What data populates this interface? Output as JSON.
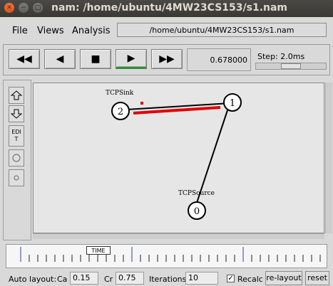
{
  "window": {
    "title": "nam: /home/ubuntu/4MW23CS153/s1.nam",
    "close_icon": "close-icon",
    "min_icon": "minimize-icon",
    "max_icon": "maximize-icon"
  },
  "menu": {
    "file": "File",
    "views": "Views",
    "analysis": "Analysis",
    "path": "/home/ubuntu/4MW23CS153/s1.nam"
  },
  "controls": {
    "rewind_icon": "rewind-icon",
    "back_icon": "step-back-icon",
    "stop_icon": "stop-icon",
    "play_icon": "play-icon",
    "forward_icon": "fast-forward-icon",
    "time": "0.678000",
    "step_label": "Step: 2.0ms"
  },
  "left_tools": {
    "zoom_in_icon": "zoom-in-icon",
    "zoom_out_icon": "zoom-out-icon",
    "edit": "EDIT",
    "circle_icon": "circle-icon",
    "small_circle_icon": "small-circle-icon"
  },
  "network": {
    "nodes": [
      {
        "id": "0",
        "label": "TCPSource"
      },
      {
        "id": "1",
        "label": ""
      },
      {
        "id": "2",
        "label": "TCPSink"
      }
    ],
    "packet_color": "#e00000",
    "link_color": "#000000"
  },
  "timeline": {
    "marker_label": "TIME"
  },
  "bottom": {
    "auto_layout": "Auto layout:",
    "ca_label": "Ca",
    "ca_value": "0.15",
    "cr_label": "Cr",
    "cr_value": "0.75",
    "iterations_label": "Iterations",
    "iterations_value": "10",
    "recalc_label": "Recalc",
    "recalc_checked": true,
    "relayout": "re-layout",
    "reset": "reset"
  }
}
